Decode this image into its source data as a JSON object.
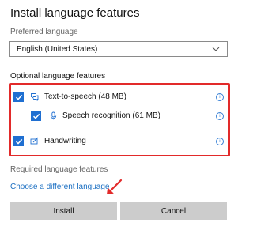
{
  "dialog": {
    "title": "Install language features",
    "preferred_language_label": "Preferred language",
    "preferred_language_value": "English (United States)",
    "optional_features_label": "Optional language features",
    "features": [
      {
        "label": "Text-to-speech (48 MB)",
        "checked": true,
        "icon": "speech-bubble-icon"
      },
      {
        "label": "Speech recognition (61 MB)",
        "checked": true,
        "icon": "microphone-icon"
      },
      {
        "label": "Handwriting",
        "checked": true,
        "icon": "handwriting-icon"
      }
    ],
    "required_features_label": "Required language features",
    "choose_language_link": "Choose a different language",
    "install_button": "Install",
    "cancel_button": "Cancel"
  },
  "colors": {
    "accent": "#1f6fd1",
    "link": "#1b6fc2",
    "highlight_box": "#e22a2a",
    "button_bg": "#cccccc"
  }
}
